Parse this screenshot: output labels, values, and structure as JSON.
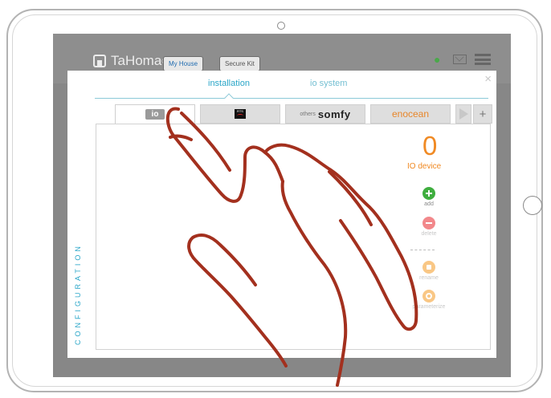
{
  "app": {
    "logo_text": "TaHoma",
    "logo_mark": "®",
    "tab_my_house": "My House",
    "tab_secure_kit": "Secure Kit",
    "user_icon": "user-icon",
    "mail_icon": "mail-icon",
    "menu_icon": "menu-icon"
  },
  "modal": {
    "close_label": "×",
    "subtabs": [
      {
        "label": "installation",
        "active": true
      },
      {
        "label": "io system",
        "active": false
      }
    ],
    "protocol_tabs": {
      "io": "io",
      "rts": "RTS",
      "others": "others",
      "somfy": "somfy",
      "enocean": "enocean",
      "plus": "+"
    },
    "section_label": "CONFIGURATION",
    "device_count": "0",
    "device_label": "IO device",
    "actions": {
      "add": "add",
      "delete": "delete",
      "separator": "------",
      "rename": "rename",
      "parameterize": "parameterize"
    },
    "colors": {
      "accent": "#2aa6c8",
      "count": "#f08a24",
      "add": "#3fae3f",
      "delete": "#f2888b",
      "rename": "#f9c785"
    }
  }
}
